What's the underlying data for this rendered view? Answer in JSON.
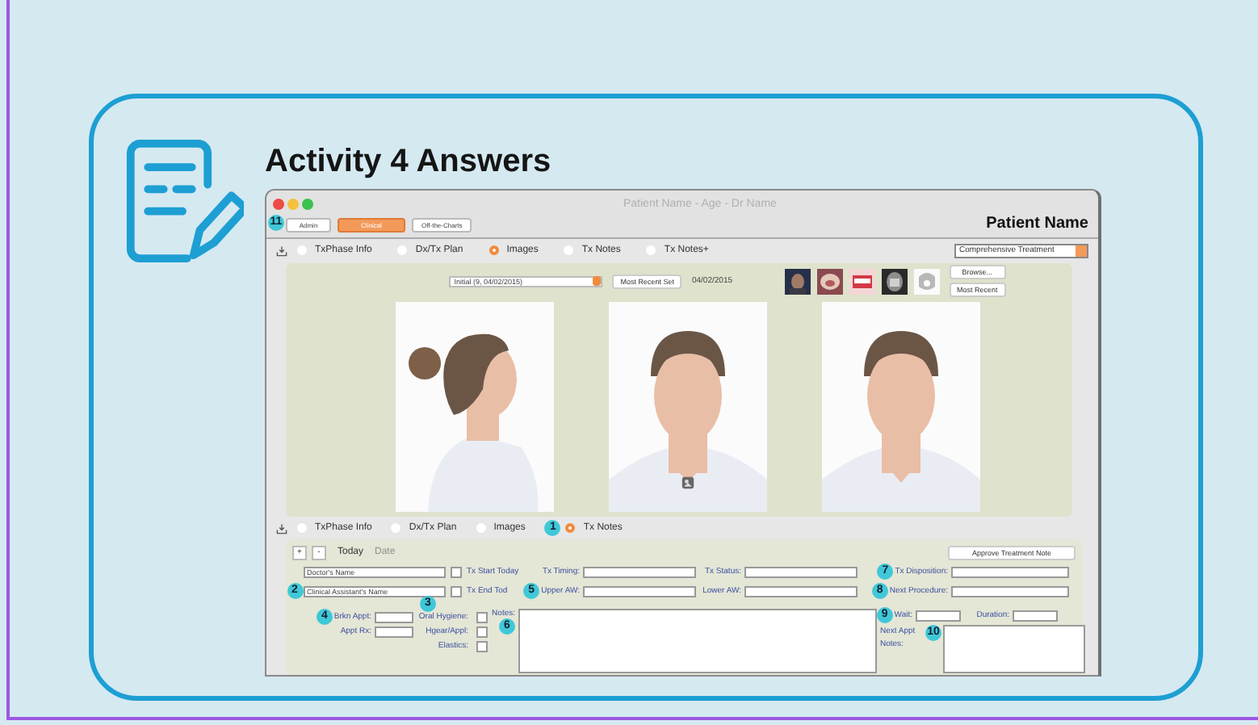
{
  "slide": {
    "title": "Activity 4 Answers"
  },
  "app": {
    "window_title": "Patient Name - Age - Dr Name",
    "patient_name": "Patient Name",
    "top_tabs": [
      {
        "label": "Admin",
        "selected": false,
        "badge": "11"
      },
      {
        "label": "Clinical",
        "selected": true
      },
      {
        "label": "Off-the-Charts",
        "selected": false
      }
    ],
    "view_tabs": [
      {
        "label": "TxPhase Info",
        "selected": false
      },
      {
        "label": "Dx/Tx Plan",
        "selected": false
      },
      {
        "label": "Images",
        "selected": true
      },
      {
        "label": "Tx Notes",
        "selected": false
      },
      {
        "label": "Tx Notes+",
        "selected": false
      }
    ],
    "treatment_select": "Comprehensive Treatment",
    "images": {
      "set_select": "Initial (9, 04/02/2015)",
      "recent_set_button": "Most Recent Set",
      "date": "04/02/2015",
      "browse_button": "Browse...",
      "most_recent_button": "Most Recent"
    },
    "notes_tabs": [
      {
        "label": "TxPhase Info",
        "selected": false
      },
      {
        "label": "Dx/Tx Plan",
        "selected": false
      },
      {
        "label": "Images",
        "selected": false
      },
      {
        "label": "Tx Notes",
        "selected": true,
        "badge": "1"
      }
    ],
    "notes": {
      "add_button": "+",
      "remove_button": "-",
      "today_button": "Today",
      "date_button": {
        "label": "Date",
        "disabled": true
      },
      "approve_button": "Approve Treatment Note",
      "doctor_field": {
        "value": "Doctor's Name"
      },
      "assistant_field": {
        "value": "Clinical Assistant's Name",
        "badge": "2"
      },
      "checks": [
        {
          "label": "Tx Start Today",
          "checked": false
        },
        {
          "label": "Tx End Tod",
          "checked": false
        },
        {
          "label": "Oral Hygiene:",
          "checked": false,
          "badge": "3"
        },
        {
          "label": "Hgear/Appl:",
          "checked": false
        },
        {
          "label": "Elastics:",
          "checked": false
        }
      ],
      "fields": [
        {
          "label": "Tx Timing:"
        },
        {
          "label": "Tx Status:"
        },
        {
          "label": "Tx Disposition:",
          "badge": "7"
        },
        {
          "label": "Upper AW:",
          "badge": "5"
        },
        {
          "label": "Lower AW:"
        },
        {
          "label": "Next Procedure:",
          "badge": "8"
        },
        {
          "label": "Brkn Appt:",
          "badge": "4"
        },
        {
          "label": "Appt Rx:"
        },
        {
          "label": "Wait:",
          "badge": "9"
        },
        {
          "label": "Duration:"
        }
      ],
      "text_areas": [
        {
          "label": "Notes:",
          "badge": "6"
        },
        {
          "label": "Next Appt Notes:",
          "badge": "10"
        }
      ]
    }
  }
}
